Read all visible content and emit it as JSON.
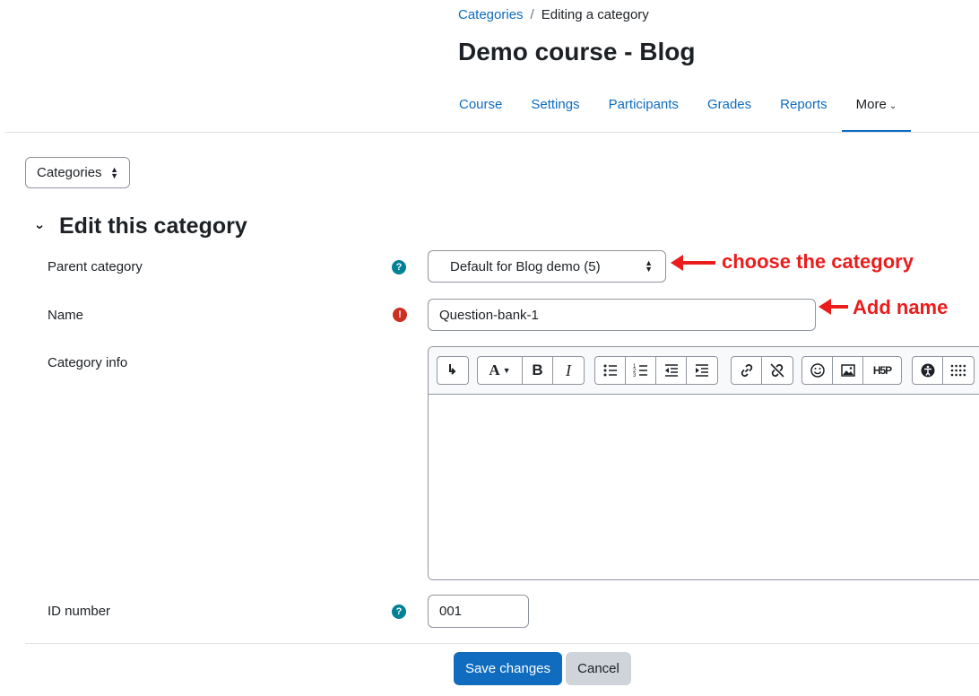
{
  "breadcrumb": {
    "link": "Categories",
    "separator": "/",
    "current": "Editing a category"
  },
  "page_title": "Demo course - Blog",
  "nav": {
    "tabs": [
      "Course",
      "Settings",
      "Participants",
      "Grades",
      "Reports",
      "More"
    ],
    "active": "More",
    "more_icon": "chevron-down-icon"
  },
  "categories_select": {
    "value": "Categories"
  },
  "section": {
    "title": "Edit this category",
    "expanded": true
  },
  "fields": {
    "parent_category": {
      "label": "Parent category",
      "value": "Default for Blog demo (5)",
      "icon": "help-icon",
      "icon_glyph": "?"
    },
    "name": {
      "label": "Name",
      "value": "Question-bank-1",
      "icon": "required-icon",
      "icon_glyph": "!"
    },
    "category_info": {
      "label": "Category info",
      "value": ""
    },
    "id_number": {
      "label": "ID number",
      "value": "001",
      "icon": "help-icon",
      "icon_glyph": "?"
    }
  },
  "editor_toolbar": {
    "font_icon_text": "A",
    "bold": "B",
    "italic": "I",
    "h5p": "H5P"
  },
  "annotations": {
    "parent": "choose the category",
    "name": "Add name",
    "color": "#ea1c1c"
  },
  "buttons": {
    "save": "Save changes",
    "cancel": "Cancel"
  },
  "colors": {
    "link": "#0f6cbf",
    "primary": "#0f6cbf",
    "help": "#008196",
    "required": "#ca3120"
  }
}
